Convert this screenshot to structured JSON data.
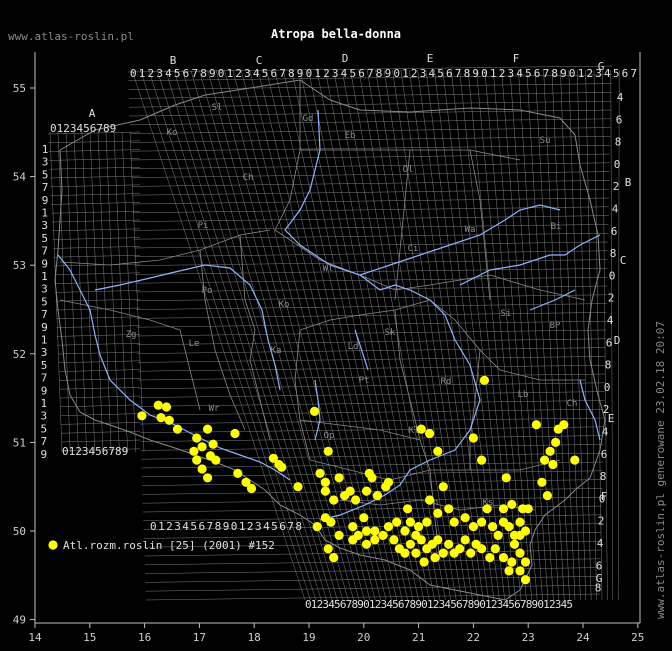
{
  "header": {
    "site": "www.atlas-roslin.pl",
    "title": "Atropa bella-donna"
  },
  "side_note": "www.atlas-roslin.pl generowane 23.02.18 20:07",
  "legend": {
    "label": "Atl.rozm.roslin [25] (2001) #152",
    "marker_color": "#ffff00"
  },
  "colors": {
    "background": "#000000",
    "grid": "#8c8c8c",
    "river": "#8fb3ff",
    "border": "#8a8a8a",
    "marker": "#ffff00"
  },
  "axes": {
    "x_ticks": [
      "14",
      "15",
      "16",
      "17",
      "18",
      "19",
      "20",
      "21",
      "22",
      "23",
      "24",
      "25"
    ],
    "y_ticks": [
      "55",
      "54",
      "53",
      "52",
      "51",
      "50",
      "49"
    ]
  },
  "grid_letters_top": [
    "A",
    "B",
    "C",
    "D",
    "E",
    "F",
    "G"
  ],
  "grid_letters_right": [
    "B",
    "C",
    "D",
    "E",
    "F",
    "G"
  ],
  "grid_digit_rows": {
    "top_A": "0123456789",
    "top_B_G": "0123456789012345678901234567890123456789012345678901234567",
    "bottom_left": "0123456789",
    "bottom_mid": "0123456789012345678",
    "bottom_main": "0123456789012345678901234567890123456789012345",
    "left_col": [
      "1",
      "3",
      "5",
      "7",
      "9",
      "1",
      "3",
      "5",
      "7",
      "9",
      "1",
      "3",
      "5",
      "7",
      "9",
      "1",
      "3",
      "5",
      "7",
      "9",
      "1",
      "3",
      "5",
      "7",
      "9"
    ],
    "right_col": [
      "4",
      "6",
      "8",
      "0",
      "2",
      "4",
      "6",
      "8",
      "0",
      "2",
      "4",
      "6",
      "8",
      "0",
      "2",
      "4",
      "6",
      "8",
      "0",
      "2",
      "4",
      "6",
      "8"
    ]
  },
  "region_codes": [
    {
      "code": "Sl"
    },
    {
      "code": "Gd"
    },
    {
      "code": "Eb"
    },
    {
      "code": "Ko"
    },
    {
      "code": "Su"
    },
    {
      "code": "Ch"
    },
    {
      "code": "Ol"
    },
    {
      "code": "Pi"
    },
    {
      "code": "Ci"
    },
    {
      "code": "Bi"
    },
    {
      "code": "Wl"
    },
    {
      "code": "Po"
    },
    {
      "code": "Ko"
    },
    {
      "code": "Wa"
    },
    {
      "code": "Si"
    },
    {
      "code": "Zg"
    },
    {
      "code": "Le"
    },
    {
      "code": "Ka"
    },
    {
      "code": "Ld"
    },
    {
      "code": "Sk"
    },
    {
      "code": "BP"
    },
    {
      "code": "Pt"
    },
    {
      "code": "Rd"
    },
    {
      "code": "Lb"
    },
    {
      "code": "Ch"
    },
    {
      "code": "Wr"
    },
    {
      "code": "Op"
    },
    {
      "code": "Kl"
    },
    {
      "code": "Tn"
    },
    {
      "code": "Ks"
    }
  ],
  "occurrences": [
    [
      15.95,
      51.3
    ],
    [
      16.25,
      51.42
    ],
    [
      16.4,
      51.4
    ],
    [
      16.45,
      51.25
    ],
    [
      16.6,
      51.15
    ],
    [
      16.3,
      51.28
    ],
    [
      16.95,
      51.05
    ],
    [
      16.9,
      50.9
    ],
    [
      17.05,
      50.95
    ],
    [
      17.15,
      51.15
    ],
    [
      17.25,
      50.98
    ],
    [
      17.3,
      50.8
    ],
    [
      17.05,
      50.7
    ],
    [
      17.15,
      50.6
    ],
    [
      17.2,
      50.85
    ],
    [
      16.95,
      50.8
    ],
    [
      17.65,
      51.1
    ],
    [
      17.7,
      50.65
    ],
    [
      17.85,
      50.55
    ],
    [
      17.95,
      50.48
    ],
    [
      18.35,
      50.82
    ],
    [
      18.45,
      50.75
    ],
    [
      18.5,
      50.72
    ],
    [
      18.8,
      50.5
    ],
    [
      19.1,
      51.35
    ],
    [
      19.2,
      50.65
    ],
    [
      19.3,
      50.55
    ],
    [
      19.35,
      50.9
    ],
    [
      19.3,
      50.45
    ],
    [
      19.45,
      50.35
    ],
    [
      19.15,
      50.05
    ],
    [
      19.3,
      50.15
    ],
    [
      19.55,
      50.6
    ],
    [
      19.65,
      50.4
    ],
    [
      19.75,
      50.45
    ],
    [
      19.85,
      50.35
    ],
    [
      20.05,
      50.45
    ],
    [
      20.15,
      50.6
    ],
    [
      20.25,
      50.4
    ],
    [
      20.0,
      50.15
    ],
    [
      19.8,
      50.05
    ],
    [
      19.9,
      49.95
    ],
    [
      20.05,
      49.85
    ],
    [
      20.2,
      49.9
    ],
    [
      19.4,
      50.1
    ],
    [
      19.55,
      49.95
    ],
    [
      19.35,
      49.8
    ],
    [
      19.45,
      49.7
    ],
    [
      19.8,
      49.9
    ],
    [
      20.05,
      50.0
    ],
    [
      20.2,
      50.0
    ],
    [
      20.35,
      49.95
    ],
    [
      20.45,
      50.05
    ],
    [
      20.6,
      50.1
    ],
    [
      20.75,
      50.0
    ],
    [
      20.85,
      50.1
    ],
    [
      21.0,
      50.05
    ],
    [
      21.15,
      50.1
    ],
    [
      20.55,
      49.9
    ],
    [
      20.65,
      49.8
    ],
    [
      20.75,
      49.75
    ],
    [
      20.85,
      49.85
    ],
    [
      20.95,
      49.75
    ],
    [
      21.05,
      49.9
    ],
    [
      21.15,
      49.8
    ],
    [
      21.25,
      49.85
    ],
    [
      21.35,
      49.9
    ],
    [
      21.45,
      49.75
    ],
    [
      21.55,
      49.85
    ],
    [
      21.65,
      49.75
    ],
    [
      21.75,
      49.8
    ],
    [
      21.85,
      49.9
    ],
    [
      21.95,
      49.75
    ],
    [
      22.05,
      49.85
    ],
    [
      22.15,
      49.8
    ],
    [
      21.35,
      50.2
    ],
    [
      21.55,
      50.25
    ],
    [
      21.65,
      50.1
    ],
    [
      21.85,
      50.15
    ],
    [
      22.0,
      50.05
    ],
    [
      22.15,
      50.1
    ],
    [
      22.25,
      50.25
    ],
    [
      22.35,
      50.05
    ],
    [
      22.45,
      49.95
    ],
    [
      22.55,
      50.1
    ],
    [
      22.65,
      50.05
    ],
    [
      22.75,
      49.95
    ],
    [
      22.85,
      50.1
    ],
    [
      22.95,
      50.0
    ],
    [
      22.75,
      49.85
    ],
    [
      22.85,
      49.75
    ],
    [
      22.95,
      49.65
    ],
    [
      22.7,
      49.65
    ],
    [
      22.55,
      49.7
    ],
    [
      22.4,
      49.8
    ],
    [
      22.3,
      49.7
    ],
    [
      22.85,
      49.55
    ],
    [
      22.95,
      49.45
    ],
    [
      22.9,
      50.25
    ],
    [
      22.7,
      50.3
    ],
    [
      22.55,
      50.25
    ],
    [
      20.8,
      50.25
    ],
    [
      21.2,
      50.35
    ],
    [
      20.95,
      49.95
    ],
    [
      21.3,
      49.7
    ],
    [
      21.1,
      49.65
    ],
    [
      22.2,
      51.7
    ],
    [
      21.05,
      51.15
    ],
    [
      21.2,
      51.1
    ],
    [
      21.35,
      50.9
    ],
    [
      22.0,
      51.05
    ],
    [
      22.15,
      50.8
    ],
    [
      22.6,
      50.6
    ],
    [
      23.25,
      50.55
    ],
    [
      23.3,
      50.8
    ],
    [
      23.4,
      50.9
    ],
    [
      23.45,
      50.75
    ],
    [
      23.5,
      51.0
    ],
    [
      23.55,
      51.15
    ],
    [
      23.85,
      50.8
    ],
    [
      23.35,
      50.4
    ],
    [
      23.15,
      51.2
    ],
    [
      23.65,
      51.2
    ],
    [
      21.45,
      50.5
    ],
    [
      20.45,
      50.55
    ],
    [
      20.1,
      50.65
    ],
    [
      20.4,
      50.5
    ],
    [
      22.65,
      49.55
    ],
    [
      22.85,
      49.95
    ],
    [
      23.0,
      50.25
    ]
  ]
}
